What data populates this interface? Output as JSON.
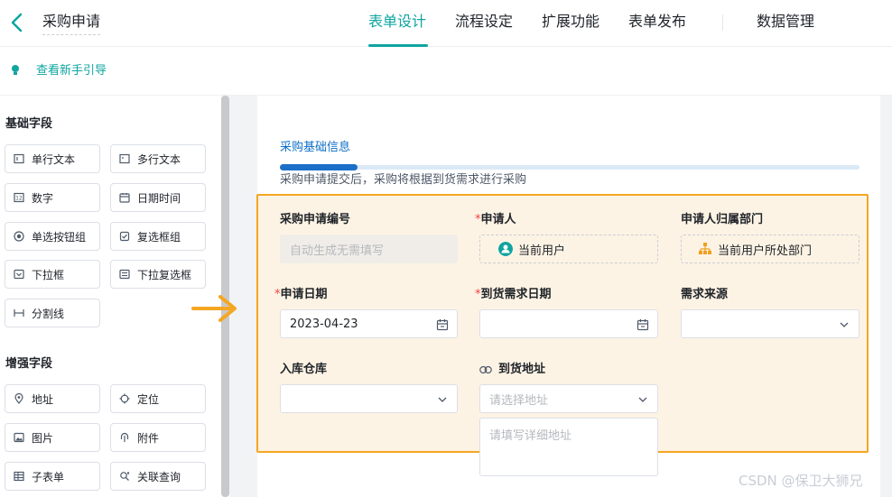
{
  "header": {
    "app_title": "采购申请",
    "tabs": [
      "表单设计",
      "流程设定",
      "扩展功能",
      "表单发布",
      "数据管理"
    ],
    "active_tab": "表单设计"
  },
  "guide": {
    "label": "查看新手引导"
  },
  "sidebar": {
    "basic_title": "基础字段",
    "basic_fields": [
      {
        "label": "单行文本",
        "icon": "single-line-text-icon"
      },
      {
        "label": "多行文本",
        "icon": "multi-line-text-icon"
      },
      {
        "label": "数字",
        "icon": "number-icon"
      },
      {
        "label": "日期时间",
        "icon": "calendar-icon"
      },
      {
        "label": "单选按钮组",
        "icon": "radio-icon"
      },
      {
        "label": "复选框组",
        "icon": "checkbox-icon"
      },
      {
        "label": "下拉框",
        "icon": "dropdown-icon"
      },
      {
        "label": "下拉复选框",
        "icon": "multi-dropdown-icon"
      },
      {
        "label": "分割线",
        "icon": "divider-icon"
      }
    ],
    "advanced_title": "增强字段",
    "advanced_fields": [
      {
        "label": "地址",
        "icon": "location-pin-icon"
      },
      {
        "label": "定位",
        "icon": "crosshair-icon"
      },
      {
        "label": "图片",
        "icon": "image-icon"
      },
      {
        "label": "附件",
        "icon": "attachment-icon"
      },
      {
        "label": "子表单",
        "icon": "subform-icon"
      },
      {
        "label": "关联查询",
        "icon": "linked-query-icon"
      }
    ]
  },
  "form": {
    "section_title": "采购基础信息",
    "section_desc": "采购申请提交后，采购将根据到货需求进行采购",
    "fields": {
      "request_no": {
        "label": "采购申请编号",
        "placeholder": "自动生成无需填写"
      },
      "applicant": {
        "required": "*",
        "label": "申请人",
        "value": "当前用户"
      },
      "department": {
        "label": "申请人归属部门",
        "value": "当前用户所处部门"
      },
      "apply_date": {
        "required": "*",
        "label": "申请日期",
        "value": "2023-04-23"
      },
      "arrival_date": {
        "required": "*",
        "label": "到货需求日期",
        "value": ""
      },
      "demand_source": {
        "label": "需求来源",
        "value": ""
      },
      "warehouse": {
        "label": "入库仓库",
        "value": ""
      },
      "address": {
        "label": "到货地址",
        "select_placeholder": "请选择地址",
        "detail_placeholder": "请填写详细地址"
      }
    }
  },
  "colors": {
    "accent": "#0fa5a0",
    "highlight_border": "#f5a623",
    "section_blue": "#1b6fc8",
    "required": "#f53f3f"
  },
  "watermark": "CSDN @保卫大狮兄"
}
